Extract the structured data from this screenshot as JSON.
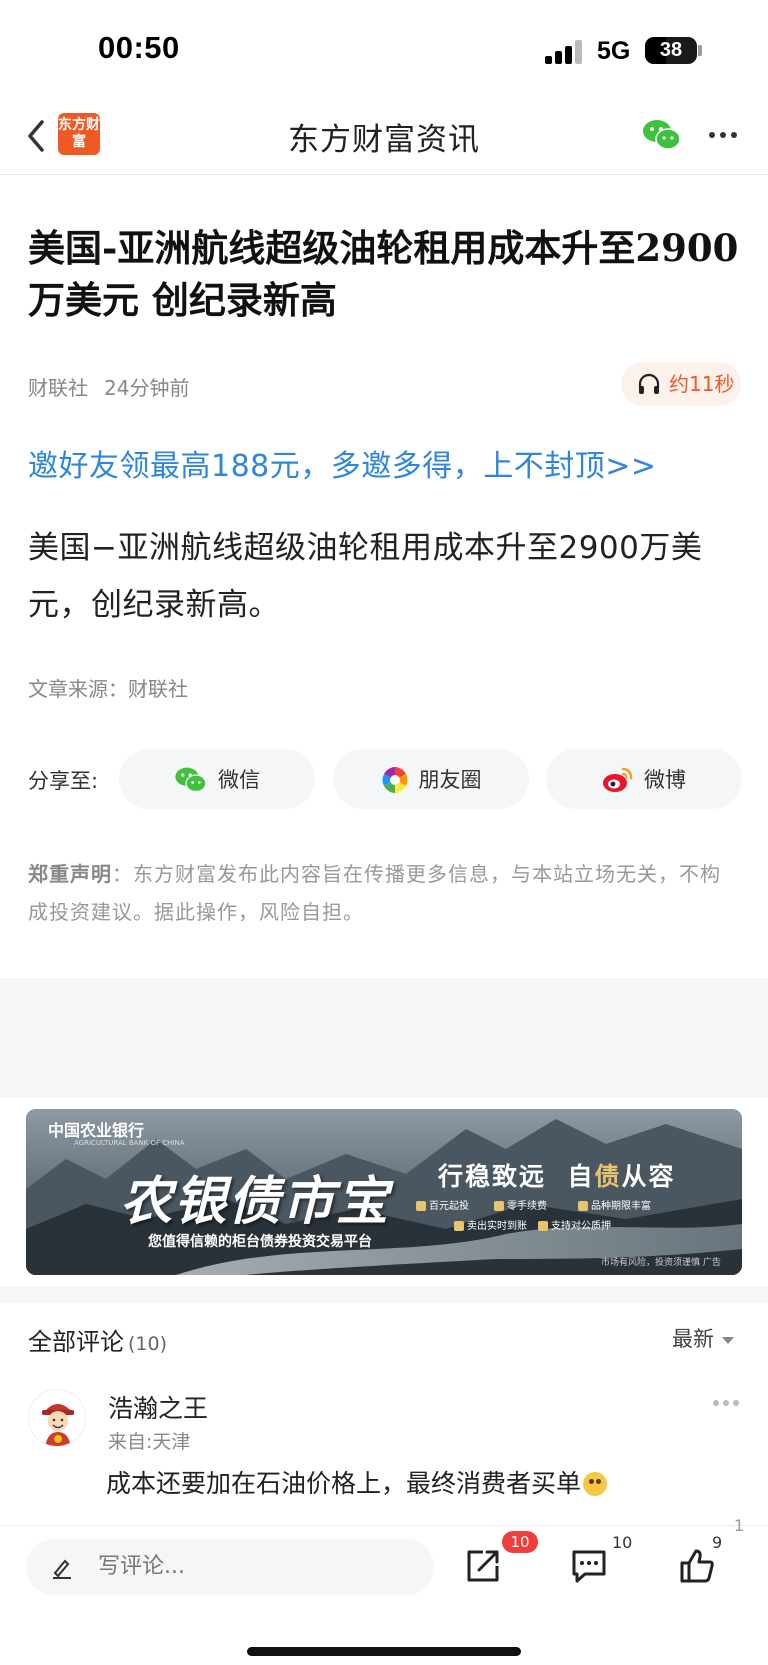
{
  "status_bar": {
    "time": "00:50",
    "network": "5G",
    "battery": "38"
  },
  "nav": {
    "logo_text": "东方财富",
    "title": "东方财富资讯"
  },
  "article": {
    "title": "美国-亚洲航线超级油轮租用成本升至2900万美元 创纪录新高",
    "source_name": "财联社",
    "time_ago": "24分钟前",
    "audio_label": "约11秒",
    "promo_link": "邀好友领最高188元，多邀多得，上不封顶>>",
    "body": "美国−亚洲航线超级油轮租用成本升至2900万美元，创纪录新高。",
    "source_line": "文章来源：财联社"
  },
  "share": {
    "label": "分享至:",
    "buttons": [
      {
        "label": "微信",
        "icon": "wechat-icon"
      },
      {
        "label": "朋友圈",
        "icon": "moments-icon"
      },
      {
        "label": "微博",
        "icon": "weibo-icon"
      }
    ]
  },
  "disclaimer": {
    "bold": "郑重声明",
    "text": "：东方财富发布此内容旨在传播更多信息，与本站立场无关，不构成投资建议。据此操作，风险自担。"
  },
  "ad": {
    "bank": "中国农业银行",
    "bank_en": "AGRICULTURAL BANK OF CHINA",
    "brand": "农银债市宝",
    "subtitle": "您值得信赖的柜台债券投资交易平台",
    "slogan_a": "行稳致远",
    "slogan_b": "自",
    "slogan_hl": "债",
    "slogan_c": "从容",
    "features": [
      "百元起投",
      "零手续费",
      "品种期限丰富",
      "卖出实时到账",
      "支持对公质押"
    ],
    "note": "市场有风险，投资须谨慎",
    "tag": "广告"
  },
  "comments": {
    "title": "全部评论",
    "count": "(10)",
    "sort_label": "最新",
    "items": [
      {
        "user": "浩瀚之王",
        "location": "来自:天津",
        "text": "成本还要加在石油价格上，最终消费者买单"
      }
    ]
  },
  "bottom_bar": {
    "input_placeholder": "写评论...",
    "share_badge": "10",
    "comment_count": "10",
    "like_count": "9",
    "peek_count": "1"
  },
  "colors": {
    "brand": "#ef5a24",
    "link": "#2e86de",
    "badge": "#f23d3d"
  }
}
